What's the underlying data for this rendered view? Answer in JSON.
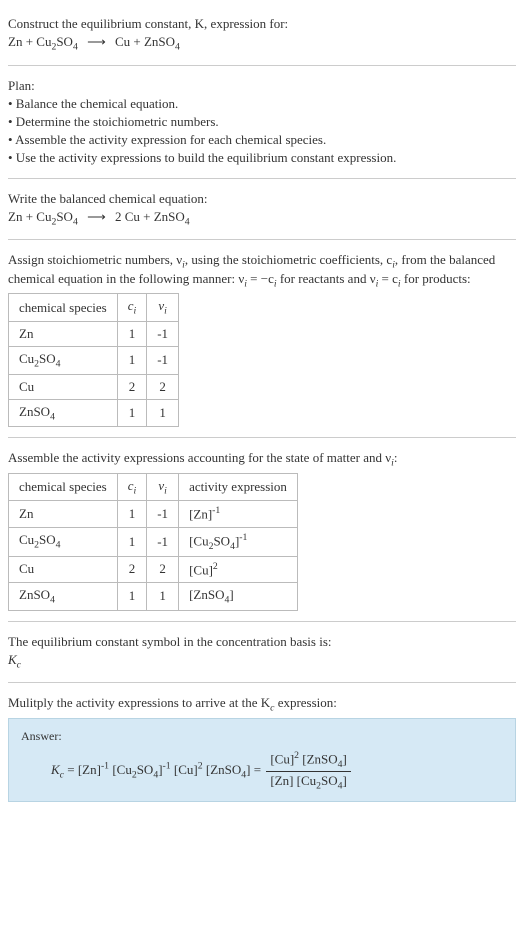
{
  "header": {
    "title": "Construct the equilibrium constant, K, expression for:",
    "equation_lhs_1": "Zn + Cu",
    "equation_lhs_2": "SO",
    "equation_rhs_1": "Cu + ZnSO"
  },
  "plan": {
    "title": "Plan:",
    "items": [
      "• Balance the chemical equation.",
      "• Determine the stoichiometric numbers.",
      "• Assemble the activity expression for each chemical species.",
      "• Use the activity expressions to build the equilibrium constant expression."
    ]
  },
  "balanced": {
    "title": "Write the balanced chemical equation:",
    "lhs_1": "Zn + Cu",
    "rhs_1": "2 Cu + ZnSO"
  },
  "stoich": {
    "intro_1": "Assign stoichiometric numbers, ν",
    "intro_2": ", using the stoichiometric coefficients, c",
    "intro_3": ", from the balanced chemical equation in the following manner: ν",
    "intro_4": " = −c",
    "intro_5": " for reactants and ν",
    "intro_6": " = c",
    "intro_7": " for products:",
    "headers": [
      "chemical species",
      "c",
      "ν"
    ],
    "rows": [
      {
        "species_a": "Zn",
        "species_b": "",
        "ci": "1",
        "vi": "-1"
      },
      {
        "species_a": "Cu",
        "species_b": "SO",
        "ci": "1",
        "vi": "-1"
      },
      {
        "species_a": "Cu",
        "species_b": "",
        "ci": "2",
        "vi": "2"
      },
      {
        "species_a": "ZnSO",
        "species_b": "",
        "ci": "1",
        "vi": "1"
      }
    ]
  },
  "activity": {
    "intro": "Assemble the activity expressions accounting for the state of matter and ν",
    "intro2": ":",
    "headers": [
      "chemical species",
      "c",
      "ν",
      "activity expression"
    ],
    "rows": [
      {
        "species_a": "Zn",
        "ci": "1",
        "vi": "-1",
        "expr_base": "[Zn]",
        "expr_sup": "-1"
      },
      {
        "species_a": "Cu",
        "species_b": "SO",
        "ci": "1",
        "vi": "-1",
        "expr_base1": "[Cu",
        "expr_base2": "SO",
        "expr_base3": "]",
        "expr_sup": "-1"
      },
      {
        "species_a": "Cu",
        "ci": "2",
        "vi": "2",
        "expr_base": "[Cu]",
        "expr_sup": "2"
      },
      {
        "species_a": "ZnSO",
        "ci": "1",
        "vi": "1",
        "expr_base1": "[ZnSO",
        "expr_base2": "]"
      }
    ]
  },
  "eqsym": {
    "text": "The equilibrium constant symbol in the concentration basis is:",
    "sym": "K"
  },
  "mult": {
    "text": "Mulitply the activity expressions to arrive at the K",
    "text2": " expression:"
  },
  "answer": {
    "label": "Answer:",
    "lhs": "K",
    "eq1_a": " = [Zn]",
    "eq1_b": " [Cu",
    "eq1_c": "SO",
    "eq1_d": "]",
    "eq1_e": " [Cu]",
    "eq1_f": " [ZnSO",
    "eq1_g": "] = ",
    "num_a": "[Cu]",
    "num_b": " [ZnSO",
    "num_c": "]",
    "den_a": "[Zn] [Cu",
    "den_b": "SO",
    "den_c": "]"
  },
  "chart_data": {
    "type": "table",
    "tables": [
      {
        "title": "stoichiometric numbers",
        "columns": [
          "chemical species",
          "c_i",
          "ν_i"
        ],
        "rows": [
          [
            "Zn",
            1,
            -1
          ],
          [
            "Cu2SO4",
            1,
            -1
          ],
          [
            "Cu",
            2,
            2
          ],
          [
            "ZnSO4",
            1,
            1
          ]
        ]
      },
      {
        "title": "activity expressions",
        "columns": [
          "chemical species",
          "c_i",
          "ν_i",
          "activity expression"
        ],
        "rows": [
          [
            "Zn",
            1,
            -1,
            "[Zn]^-1"
          ],
          [
            "Cu2SO4",
            1,
            -1,
            "[Cu2SO4]^-1"
          ],
          [
            "Cu",
            2,
            2,
            "[Cu]^2"
          ],
          [
            "ZnSO4",
            1,
            1,
            "[ZnSO4]"
          ]
        ]
      }
    ]
  }
}
